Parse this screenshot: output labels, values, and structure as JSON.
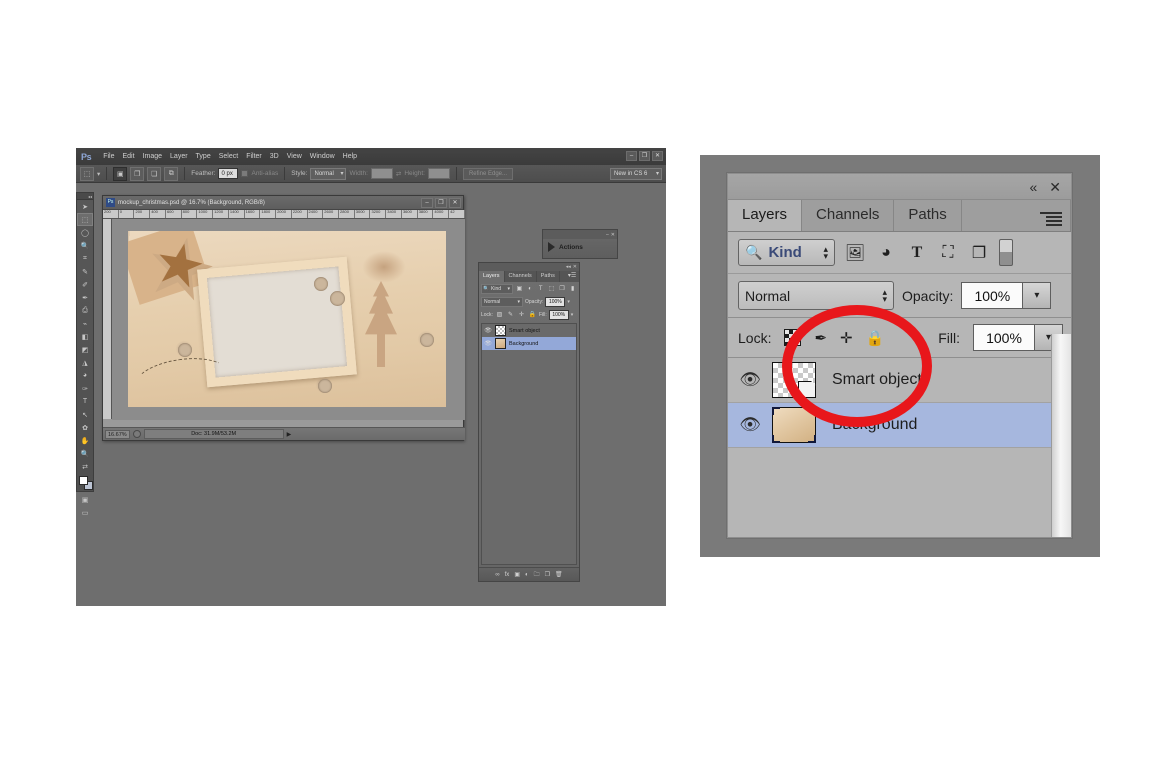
{
  "app": {
    "logo": "Ps",
    "menu_items": [
      "File",
      "Edit",
      "Image",
      "Layer",
      "Type",
      "Select",
      "Filter",
      "3D",
      "View",
      "Window",
      "Help"
    ],
    "window_controls": [
      "–",
      "❐",
      "✕"
    ]
  },
  "options_bar": {
    "tool_icon": "marquee-icon",
    "tool_dropdown": "▾",
    "mode_buttons": [
      "new-selection-icon",
      "add-to-selection-icon",
      "subtract-from-selection-icon",
      "intersect-selection-icon"
    ],
    "feather_label": "Feather:",
    "feather_value": "0 px",
    "antialias_label": "Anti-alias",
    "style_label": "Style:",
    "style_value": "Normal",
    "width_label": "Width:",
    "width_value": "",
    "swap_icon": "swap-icon",
    "height_label": "Height:",
    "height_value": "",
    "refine_edge_label": "Refine Edge...",
    "workspace_value": "New in CS 6"
  },
  "toolbox": {
    "tools": [
      "move-icon",
      "marquee-icon",
      "lasso-icon",
      "quick-select-icon",
      "crop-icon",
      "eyedropper-icon",
      "healing-brush-icon",
      "brush-icon",
      "clone-stamp-icon",
      "history-brush-icon",
      "eraser-icon",
      "gradient-icon",
      "blur-icon",
      "dodge-icon",
      "pen-icon",
      "type-icon",
      "path-select-icon",
      "shape-icon",
      "hand-icon",
      "zoom-icon",
      "edit-toolbar-icon"
    ],
    "foreground_color": "#ffffff",
    "background_color": "#bcc4d4",
    "quickmask_icon": "quick-mask-icon",
    "screenmode_icon": "screen-mode-icon"
  },
  "document": {
    "title": "mockup_christmas.psd @ 16.7% (Background, RGB/8)",
    "file_icon": "psd-file-icon",
    "window_controls": [
      "–",
      "❐",
      "✕"
    ],
    "ruler_ticks": [
      "200",
      "0",
      "200",
      "400",
      "600",
      "800",
      "1000",
      "1200",
      "1400",
      "1600",
      "1800",
      "2000",
      "2200",
      "2400",
      "2600",
      "2800",
      "3000",
      "3200",
      "3400",
      "3600",
      "3800",
      "4000",
      "42"
    ],
    "status_zoom": "16.67%",
    "status_doc": "Doc: 31.9M/53.2M",
    "status_arrow": "▶",
    "canvas_description": "wooden christmas flat-lay photo mockup with picture frame"
  },
  "actions_panel": {
    "label": "Actions",
    "play_icon": "play-icon",
    "controls": [
      "–",
      "✕"
    ]
  },
  "layers_panel_small": {
    "tabs": [
      "Layers",
      "Channels",
      "Paths"
    ],
    "active_tab": "Layers",
    "menu_icon": "panel-menu-icon",
    "filter_kind": "Kind",
    "filter_icons": [
      "pixel-filter-icon",
      "adjustment-filter-icon",
      "type-filter-icon",
      "shape-filter-icon",
      "smart-object-filter-icon"
    ],
    "blend_mode": "Normal",
    "opacity_label": "Opacity:",
    "opacity_value": "100%",
    "lock_label": "Lock:",
    "lock_icons": [
      "lock-transparent-icon",
      "lock-image-icon",
      "lock-position-icon",
      "lock-all-icon"
    ],
    "fill_label": "Fill:",
    "fill_value": "100%",
    "layers": [
      {
        "name": "Smart object",
        "visible": true,
        "selected": false,
        "thumb": "smart-object-thumb"
      },
      {
        "name": "Background",
        "visible": true,
        "selected": true,
        "thumb": "background-thumb"
      }
    ],
    "bottom_icons": [
      "link-layers-icon",
      "layer-style-icon",
      "add-mask-icon",
      "new-adjustment-icon",
      "new-group-icon",
      "new-layer-icon",
      "delete-layer-icon"
    ]
  },
  "zoom_panel": {
    "collapse_icon": "«",
    "close_icon": "✕",
    "tabs": [
      "Layers",
      "Channels",
      "Paths"
    ],
    "active_tab": "Layers",
    "menu_icon": "panel-menu-icon",
    "filter_kind": "Kind",
    "search_icon": "search-icon",
    "stepper_icon": "stepper-icon",
    "filter_icons": [
      "pixel-filter-icon",
      "adjustment-filter-icon",
      "type-filter-icon",
      "shape-filter-icon",
      "smart-object-filter-icon"
    ],
    "filter_toggle": "filter-toggle-icon",
    "blend_mode": "Normal",
    "blend_stepper": "stepper-icon",
    "opacity_label": "Opacity:",
    "opacity_value": "100%",
    "opacity_dropdown": "▾",
    "lock_label": "Lock:",
    "lock_icons": [
      "lock-transparent-icon",
      "lock-image-icon",
      "lock-position-icon",
      "lock-all-icon"
    ],
    "fill_label": "Fill:",
    "fill_value": "100%",
    "fill_dropdown": "▾",
    "layers": [
      {
        "name": "Smart object",
        "visible": true,
        "selected": false,
        "eye_icon": "eye-icon"
      },
      {
        "name": "Background",
        "visible": true,
        "selected": true,
        "eye_icon": "eye-icon"
      }
    ]
  },
  "annotation": {
    "shape": "red-ellipse-highlight",
    "color": "#e8171b",
    "target": "layer-thumbnails"
  },
  "colors": {
    "page_background": "#ffffff",
    "app_background": "#6e6e6e",
    "panel_background": "#b6b6b6",
    "selected_layer": "#a6b7de",
    "annotation_red": "#e8171b"
  }
}
